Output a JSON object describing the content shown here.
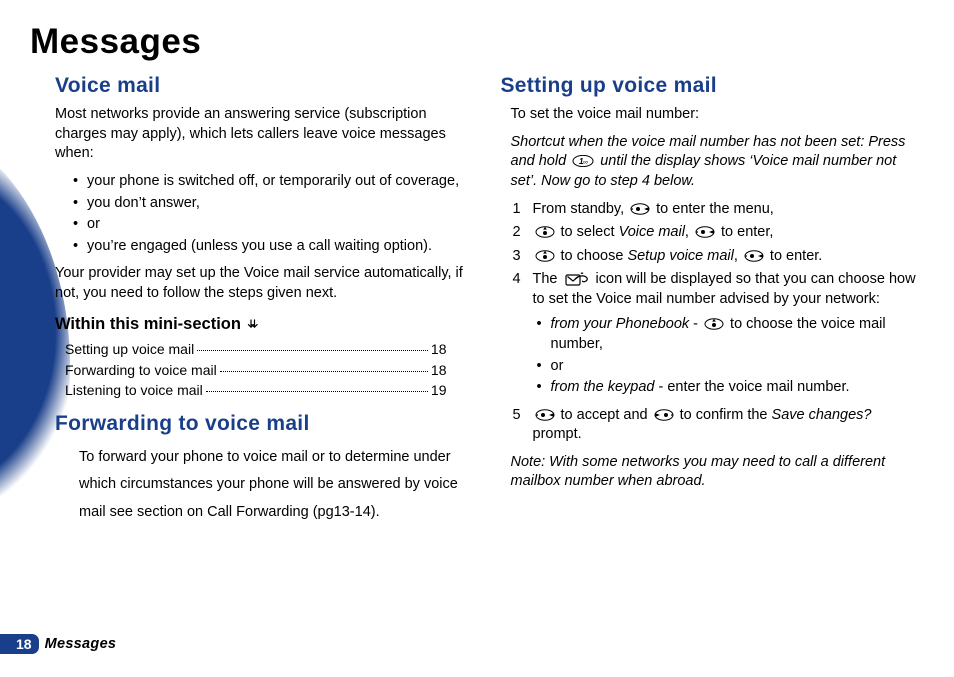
{
  "page_title": "Messages",
  "footer": {
    "page_number": "18",
    "section_label": "Messages"
  },
  "left": {
    "h_voice_mail": "Voice mail",
    "intro": "Most networks provide an answering service (subscription charges may apply), which lets callers leave voice messages when:",
    "bullets": [
      "your phone is switched off, or temporarily out of coverage,",
      "you don’t answer,",
      "or",
      "you’re engaged (unless you use a call waiting option)."
    ],
    "after_bullets": "Your provider may set up the Voice mail service automatically, if not, you need to follow the steps given next.",
    "mini_section_label": "Within this mini-section",
    "toc": [
      {
        "label": "Setting up voice mail",
        "page": "18"
      },
      {
        "label": "Forwarding to voice mail",
        "page": "18"
      },
      {
        "label": "Listening to voice mail",
        "page": "19"
      }
    ],
    "h_forwarding": "Forwarding to voice mail",
    "forwarding_body": "To forward your phone to voice mail or to determine under which circumstances your phone will be answered by voice mail see section on Call Forwarding (pg13-14)."
  },
  "right": {
    "h_setup": "Setting up voice mail",
    "intro": "To set the voice mail number:",
    "shortcut_pre": "Shortcut when the voice mail number has not been set: Press and hold ",
    "shortcut_post": " until the display shows ‘Voice mail number not set’. Now go to step 4 below.",
    "step1_pre": "From standby, ",
    "step1_post": " to enter the menu,",
    "step2_pre": "",
    "step2_mid1": " to select ",
    "step2_vm": "Voice mail",
    "step2_mid2": ", ",
    "step2_post": " to enter,",
    "step3_pre": "",
    "step3_mid1": " to choose ",
    "step3_setup": "Setup voice mail",
    "step3_mid2": ", ",
    "step3_post": " to enter.",
    "step4_pre": "The ",
    "step4_post": " icon will be displayed so that you can choose how to set the Voice mail number advised by your network:",
    "sub_a_pre": "from your Phonebook",
    "sub_a_mid": " - ",
    "sub_a_post": " to choose the voice mail number,",
    "sub_or": "or",
    "sub_b_pre": "from the keypad",
    "sub_b_post": " - enter the voice mail number.",
    "step5_pre": "",
    "step5_mid1": " to accept and ",
    "step5_mid2": " to confirm the ",
    "step5_save": "Save changes?",
    "step5_post": " prompt.",
    "note": "Note: With some networks you may need to call a different mailbox number when abroad."
  }
}
